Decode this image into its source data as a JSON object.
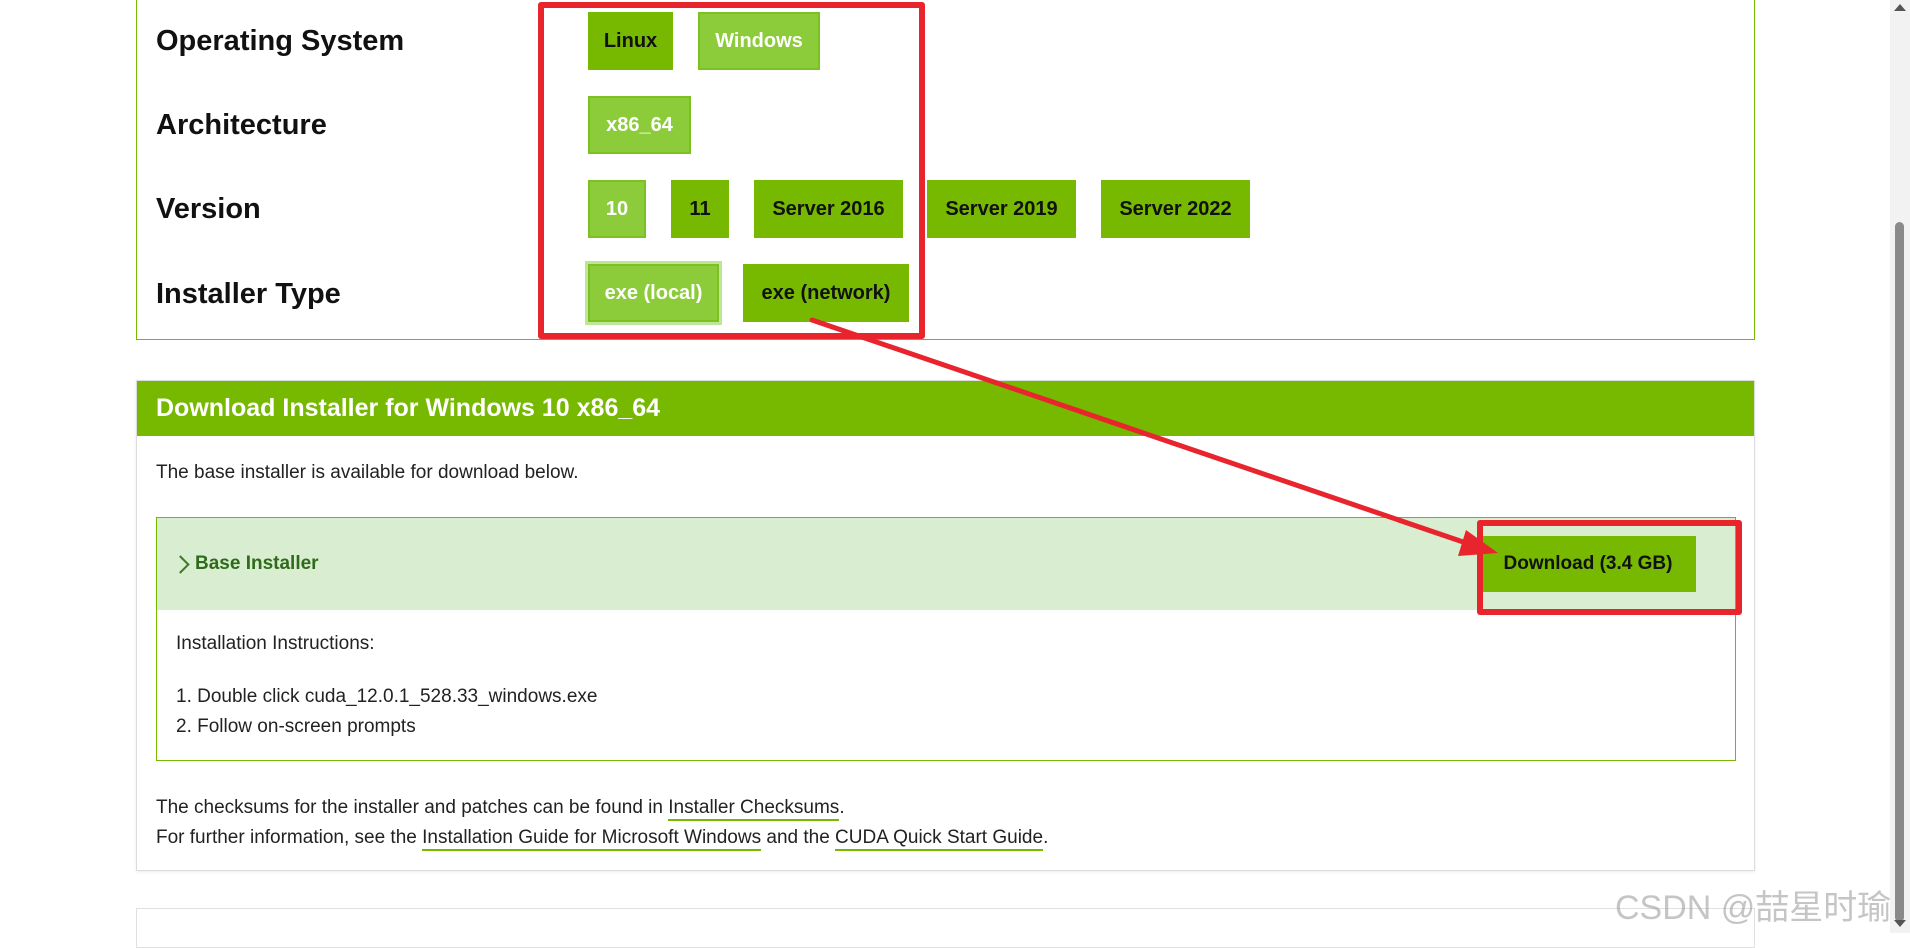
{
  "selector": {
    "labels": {
      "os": "Operating System",
      "arch": "Architecture",
      "version": "Version",
      "installer_type": "Installer Type"
    },
    "os_options": [
      "Linux",
      "Windows"
    ],
    "arch_options": [
      "x86_64"
    ],
    "version_options": [
      "10",
      "11",
      "Server 2016",
      "Server 2019",
      "Server 2022"
    ],
    "installer_type_options": [
      "exe (local)",
      "exe (network)"
    ],
    "selected": {
      "os": "Windows",
      "arch": "x86_64",
      "version": "10",
      "installer_type": "exe (local)"
    }
  },
  "download": {
    "header": "Download Installer for Windows 10 x86_64",
    "intro": "The base installer is available for download below.",
    "base_installer_title": "Base Installer",
    "download_button": "Download (3.4 GB)",
    "instructions_title": "Installation Instructions:",
    "steps": [
      "1. Double click cuda_12.0.1_528.33_windows.exe",
      "2. Follow on-screen prompts"
    ],
    "footer": {
      "checksums_prefix": "The checksums for the installer and patches can be found in ",
      "checksums_link": "Installer Checksums",
      "checksums_suffix": ".",
      "info_prefix": "For further information, see the ",
      "guide_link": "Installation Guide for Microsoft Windows",
      "info_middle": " and the ",
      "quickstart_link": "CUDA Quick Start Guide",
      "info_suffix": "."
    }
  },
  "watermark": "CSDN @喆星时瑜",
  "colors": {
    "accent_green": "#76b900",
    "selected_green": "#8ccc3a",
    "installer_header_bg": "#d9edd0",
    "annotation_red": "#e8242d"
  }
}
